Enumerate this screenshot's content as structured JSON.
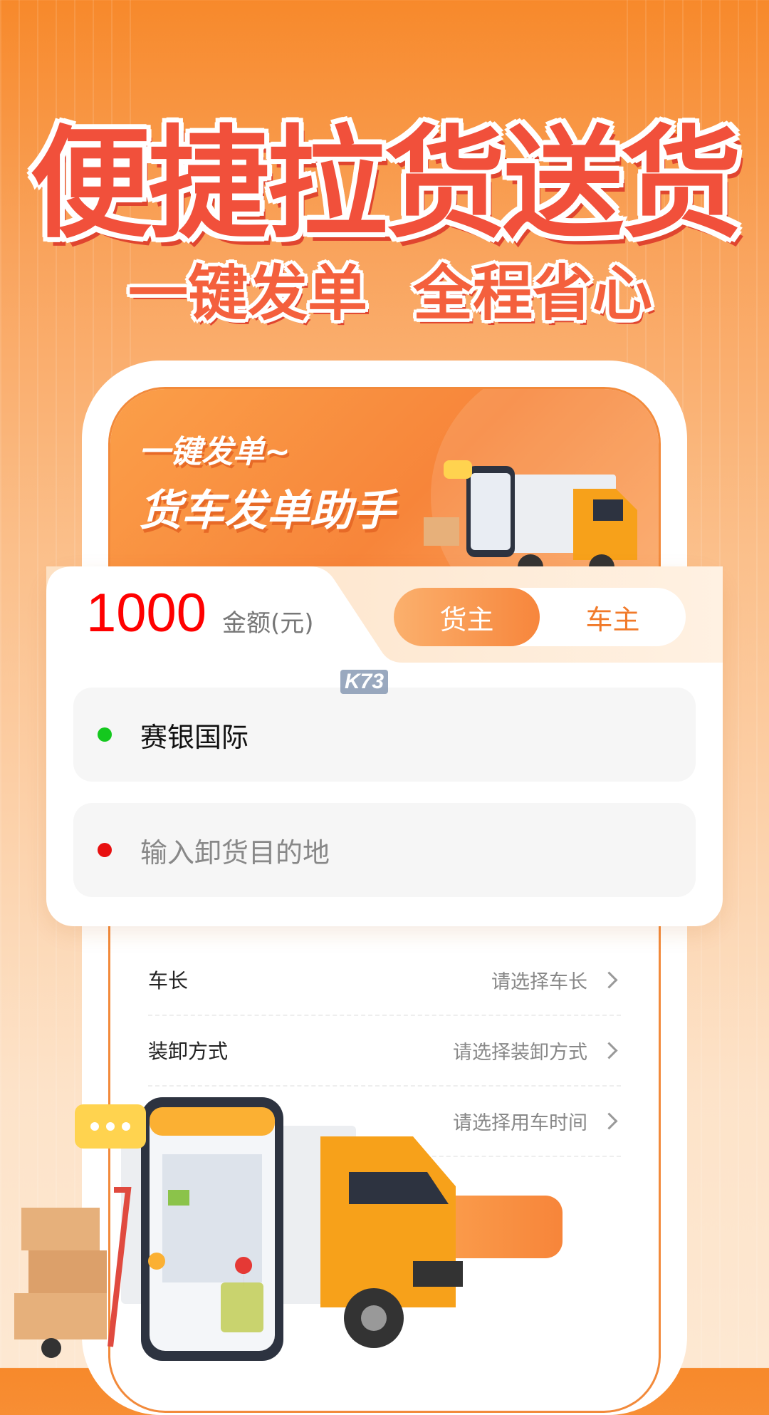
{
  "hero": {
    "title": "便捷拉货送货",
    "subtitle_left": "一键发单",
    "subtitle_right": "全程省心"
  },
  "banner": {
    "line1": "一键发单~",
    "line2": "货车发单助手"
  },
  "order_card": {
    "amount": "1000",
    "amount_label": "金额(元)",
    "roles": [
      "货主",
      "车主"
    ],
    "active_role": "货主",
    "origin": "赛银国际",
    "destination_placeholder": "输入卸货目的地"
  },
  "form": {
    "rows": [
      {
        "label": "车长",
        "value": "请选择车长"
      },
      {
        "label": "装卸方式",
        "value": "请选择装卸方式"
      },
      {
        "label": "",
        "value": "请选择用车时间"
      }
    ]
  },
  "watermark": "K73",
  "colors": {
    "accent": "#f7853a",
    "amount": "#ff0000",
    "origin_dot": "#14c81e",
    "destination_dot": "#e81010"
  }
}
